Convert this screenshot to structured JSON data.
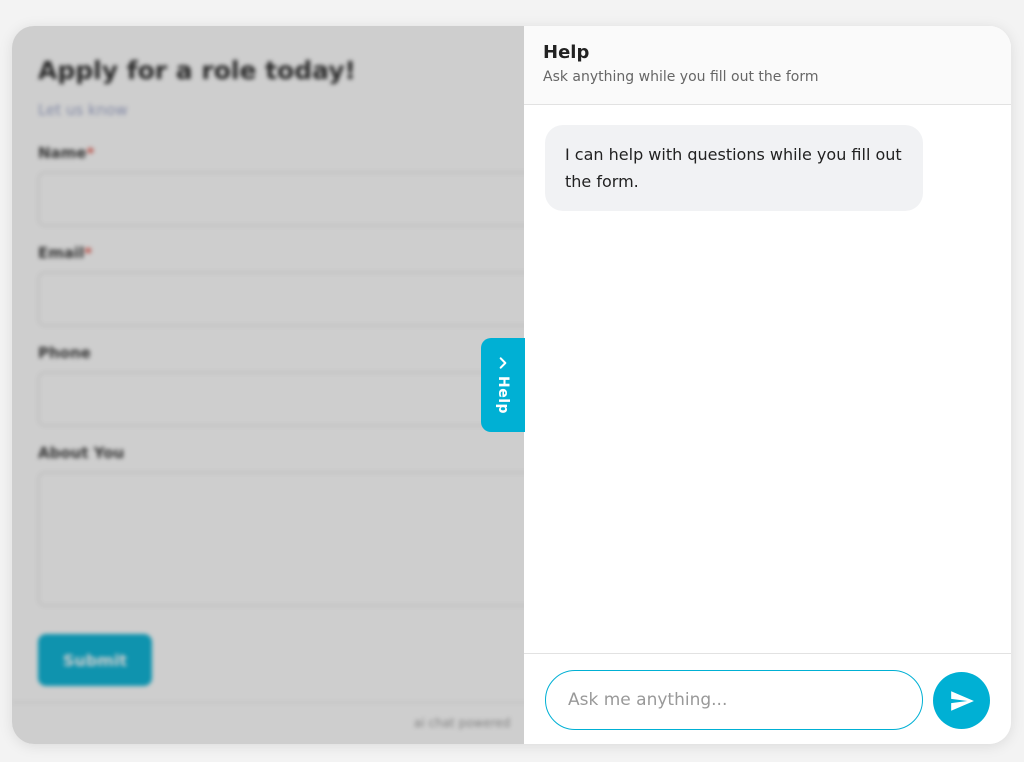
{
  "form": {
    "title": "Apply for a role today!",
    "subtitle": "Let us know",
    "fields": [
      {
        "label": "Name",
        "required_mark": "*"
      },
      {
        "label": "Email",
        "required_mark": "*"
      },
      {
        "label": "Phone"
      },
      {
        "label": "About You"
      }
    ],
    "submit_label": "Submit",
    "footer_text": "ai chat powered"
  },
  "help_tab": {
    "label": "Help",
    "icon": "chevron-right-icon"
  },
  "help_panel": {
    "title": "Help",
    "subtitle": "Ask anything while you fill out the form",
    "messages": [
      {
        "role": "assistant",
        "text": "I can help with questions while you fill out the form."
      }
    ],
    "input_placeholder": "Ask me anything...",
    "send_icon": "send-icon"
  },
  "colors": {
    "accent": "#00b0d4",
    "required": "#e0483c",
    "bubble_bg": "#f1f2f4"
  }
}
